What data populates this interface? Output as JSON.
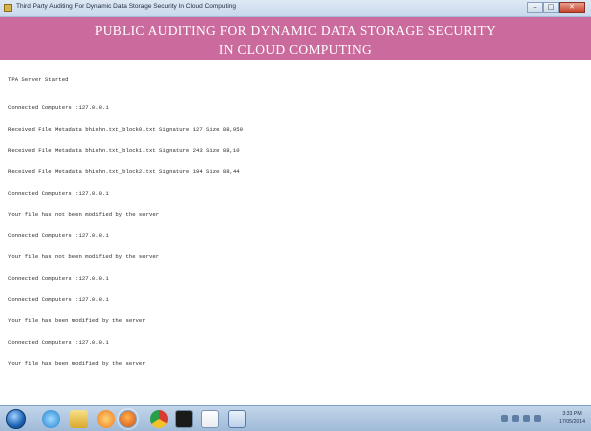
{
  "window": {
    "title": "Third Party Auditing For Dynamic Data Storage Security In Cloud Computing",
    "controls": {
      "minimize": "–",
      "maximize": "□",
      "close": "✕"
    }
  },
  "banner": {
    "line1": "PUBLIC AUDITING FOR DYNAMIC DATA STORAGE SECURITY",
    "line2": "IN CLOUD COMPUTING"
  },
  "console": {
    "status": "TPA Server Started",
    "lines": [
      "Connected Computers :127.0.0.1",
      "Received File Metadata bhishn.txt_block0.txt Signature 127 Size 88,950",
      "Received File Metadata bhishn.txt_block1.txt Signature 243 Size 88,10",
      "Received File Metadata bhishn.txt_block2.txt Signature 194 Size 88,44",
      "Connected Computers :127.0.0.1",
      "Your file has not been modified by the server",
      "Connected Computers :127.0.0.1",
      "Your file has not been modified by the server",
      "Connected Computers :127.0.0.1",
      "Connected Computers :127.0.0.1",
      "Your file has been modified by the server",
      "Connected Computers :127.0.0.1",
      "Your file has been modified by the server"
    ]
  },
  "taskbar": {
    "icons": [
      "start-orb",
      "internet-explorer-icon",
      "folder-icon",
      "media-player-icon",
      "firefox-icon",
      "chrome-icon",
      "command-prompt-icon",
      "java-icon",
      "notepad-icon"
    ],
    "clock": {
      "time": "3:33 PM",
      "date": "17/05/2014"
    }
  }
}
